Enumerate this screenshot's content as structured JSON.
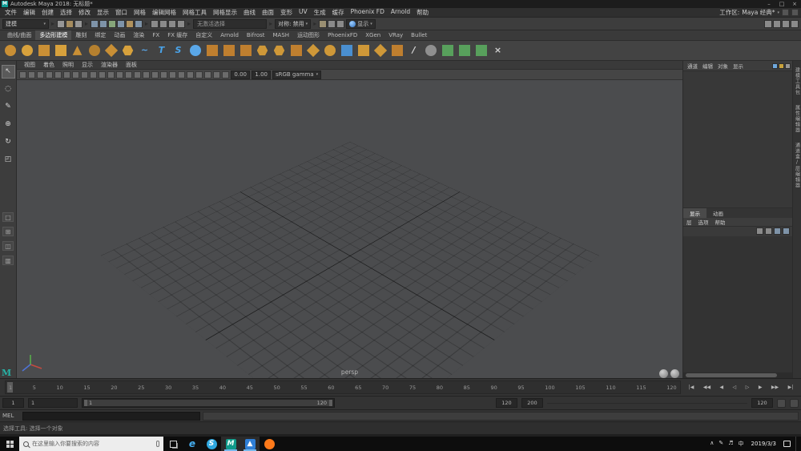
{
  "titlebar": {
    "app_glyph": "M",
    "title": "Autodesk Maya 2018: 无标题*",
    "minimize_glyph": "–",
    "maximize_glyph": "□",
    "close_glyph": "×"
  },
  "menubar": {
    "items": [
      "文件",
      "编辑",
      "创建",
      "选择",
      "修改",
      "显示",
      "窗口",
      "网格",
      "编辑网格",
      "网格工具",
      "网格显示",
      "曲线",
      "曲面",
      "变形",
      "UV",
      "生成",
      "缓存",
      "Phoenix FD",
      "Arnold",
      "帮助"
    ],
    "workspace_label": "工作区:",
    "workspace_value": "Maya 经典*"
  },
  "status_line": {
    "mode": "建模",
    "selection": "无激活选择",
    "symmetry": "对称: 禁用",
    "display": "显示",
    "file_icons": [
      {
        "name": "new-scene-icon",
        "bg": "#969696"
      },
      {
        "name": "open-scene-icon",
        "bg": "#a58c5f"
      },
      {
        "name": "save-scene-icon",
        "bg": "#969696"
      }
    ],
    "snap_icons": [
      {
        "name": "snap-to-grid-icon",
        "bg": "#7e93a8"
      },
      {
        "name": "snap-to-curve-icon",
        "bg": "#7e93a8"
      },
      {
        "name": "snap-to-point-icon",
        "bg": "#86a57a"
      },
      {
        "name": "snap-to-projected-center-icon",
        "bg": "#7e93a8"
      },
      {
        "name": "make-live-icon",
        "bg": "#b0925e"
      },
      {
        "name": "snap-to-view-plane-icon",
        "bg": "#7e93a8"
      }
    ],
    "history_icons": [
      {
        "name": "input-connections-icon",
        "bg": "#8a8a8a"
      },
      {
        "name": "output-connections-icon",
        "bg": "#8a8a8a"
      },
      {
        "name": "construction-history-icon",
        "bg": "#8a8a8a"
      },
      {
        "name": "highlight-selection-icon",
        "bg": "#8a8a8a"
      }
    ],
    "render_icons": [
      {
        "name": "render-current-frame-icon",
        "bg": "#9a8f72"
      },
      {
        "name": "ipr-render-icon",
        "bg": "#8a8a8a"
      },
      {
        "name": "render-settings-icon",
        "bg": "#8a8a8a"
      }
    ],
    "sidebar_toggles": [
      {
        "name": "attribute-editor-toggle-icon",
        "bg": "#8a8a8a"
      },
      {
        "name": "tool-settings-toggle-icon",
        "bg": "#8a8a8a"
      },
      {
        "name": "channel-box-toggle-icon",
        "bg": "#8a8a8a"
      },
      {
        "name": "modeling-toolkit-toggle-icon",
        "bg": "#8a8a8a"
      }
    ]
  },
  "shelf": {
    "tabs": [
      {
        "label": "曲线/曲面"
      },
      {
        "label": "多边形建模",
        "state": "active"
      },
      {
        "label": "雕刻"
      },
      {
        "label": "绑定"
      },
      {
        "label": "动画"
      },
      {
        "label": "渲染"
      },
      {
        "label": "FX"
      },
      {
        "label": "FX 缓存"
      },
      {
        "label": "自定义"
      },
      {
        "label": "Arnold"
      },
      {
        "label": "Bifrost"
      },
      {
        "label": "MASH"
      },
      {
        "label": "运动图形"
      },
      {
        "label": "PhoenixFD"
      },
      {
        "label": "XGen"
      },
      {
        "label": "VRay"
      },
      {
        "label": "Bullet"
      }
    ],
    "icons": [
      {
        "name": "poly-sphere-icon",
        "shape": "shp-circle",
        "bg": "#c98f35",
        "glyph": ""
      },
      {
        "name": "poly-smooth-sphere-icon",
        "shape": "shp-circle",
        "bg": "#d7a13c",
        "glyph": ""
      },
      {
        "name": "poly-cube-icon",
        "shape": "shp-square",
        "bg": "#c98f35",
        "glyph": ""
      },
      {
        "name": "poly-cylinder-icon",
        "shape": "shp-square",
        "bg": "#d7a13c",
        "glyph": ""
      },
      {
        "name": "poly-cone-icon",
        "shape": "shp-tri",
        "bg": "#c98f35",
        "glyph": ""
      },
      {
        "name": "poly-torus-icon",
        "shape": "shp-circle",
        "bg": "#b5802f",
        "glyph": ""
      },
      {
        "name": "poly-plane-icon",
        "shape": "shp-diamond",
        "bg": "#c98f35",
        "glyph": ""
      },
      {
        "name": "platonic-solid-icon",
        "shape": "shp-hex",
        "bg": "#d7a13c",
        "glyph": ""
      },
      {
        "name": "sweep-mesh-icon",
        "shape": "shp-letter",
        "fg": "#5aa7e8",
        "glyph": "~"
      },
      {
        "name": "poly-type-icon",
        "shape": "shp-letter",
        "fg": "#4aa3e8",
        "glyph": "T"
      },
      {
        "name": "svg-tool-icon",
        "shape": "shp-letter",
        "fg": "#4aa3e8",
        "glyph": "S"
      },
      {
        "name": "super-shape-icon",
        "shape": "shp-circle",
        "bg": "#5aa7e8",
        "glyph": ""
      },
      {
        "name": "boolean-union-icon",
        "shape": "shp-square",
        "bg": "#bf7f2f",
        "glyph": ""
      },
      {
        "name": "boolean-difference-icon",
        "shape": "shp-square",
        "bg": "#bf7f2f",
        "glyph": ""
      },
      {
        "name": "boolean-intersection-icon",
        "shape": "shp-square",
        "bg": "#bf7f2f",
        "glyph": ""
      },
      {
        "name": "combine-icon",
        "shape": "shp-hex",
        "bg": "#cf9838",
        "glyph": ""
      },
      {
        "name": "separate-icon",
        "shape": "shp-hex",
        "bg": "#cf9838",
        "glyph": ""
      },
      {
        "name": "extract-icon",
        "shape": "shp-square",
        "bg": "#bf7f2f",
        "glyph": ""
      },
      {
        "name": "merge-icon",
        "shape": "shp-diamond",
        "bg": "#cf9838",
        "glyph": ""
      },
      {
        "name": "smooth-icon",
        "shape": "shp-circle",
        "bg": "#cf9838",
        "glyph": ""
      },
      {
        "name": "mirror-icon",
        "shape": "shp-square",
        "bg": "#4a8fd0",
        "glyph": ""
      },
      {
        "name": "extrude-icon",
        "shape": "shp-square",
        "bg": "#cf9838",
        "glyph": ""
      },
      {
        "name": "bevel-icon",
        "shape": "shp-diamond",
        "bg": "#cf9838",
        "glyph": ""
      },
      {
        "name": "bridge-icon",
        "shape": "shp-square",
        "bg": "#bf7f2f",
        "glyph": ""
      },
      {
        "name": "multi-cut-icon",
        "shape": "shp-letter",
        "fg": "#d8d8d8",
        "glyph": "/"
      },
      {
        "name": "target-weld-icon",
        "shape": "shp-circle",
        "bg": "#8f8f8f",
        "glyph": ""
      },
      {
        "name": "quad-draw-icon",
        "shape": "shp-square",
        "bg": "#58a05c",
        "glyph": ""
      },
      {
        "name": "create-polygon-icon",
        "shape": "shp-square",
        "bg": "#58a05c",
        "glyph": ""
      },
      {
        "name": "sculpt-tool-icon",
        "shape": "shp-square",
        "bg": "#58a05c",
        "glyph": ""
      },
      {
        "name": "delete-history-icon",
        "shape": "shp-letter",
        "fg": "#cfcfcf",
        "glyph": "×"
      }
    ]
  },
  "panel_menu": {
    "items": [
      "视图",
      "着色",
      "照明",
      "显示",
      "渲染器",
      "面板"
    ]
  },
  "viewport_toolbar": {
    "icons": [
      {
        "name": "select-camera-icon"
      },
      {
        "name": "lock-camera-icon"
      },
      {
        "name": "camera-attributes-icon"
      },
      {
        "name": "bookmark-icon"
      },
      {
        "name": "image-plane-icon"
      },
      {
        "name": "2d-pan-zoom-icon"
      },
      {
        "name": "grease-pencil-icon"
      },
      {
        "name": "grid-icon"
      },
      {
        "name": "film-gate-icon"
      },
      {
        "name": "resolution-gate-icon"
      },
      {
        "name": "gate-mask-icon"
      },
      {
        "name": "field-chart-icon"
      },
      {
        "name": "safe-action-icon"
      },
      {
        "name": "safe-title-icon"
      },
      {
        "name": "wireframe-icon"
      },
      {
        "name": "shaded-icon"
      },
      {
        "name": "textured-icon"
      },
      {
        "name": "lights-icon"
      },
      {
        "name": "shadows-icon"
      },
      {
        "name": "ssao-icon"
      },
      {
        "name": "motion-blur-icon"
      },
      {
        "name": "multisample-aa-icon"
      },
      {
        "name": "depth-of-field-icon"
      },
      {
        "name": "isolate-select-icon"
      }
    ],
    "exposure": "0.00",
    "gamma": "1.00",
    "colorspace": "sRGB gamma"
  },
  "viewport": {
    "camera_label": "persp"
  },
  "toolbox": {
    "tools": [
      {
        "name": "select-tool-icon",
        "glyph": "↖",
        "state": "active"
      },
      {
        "name": "lasso-tool-icon",
        "glyph": "◌"
      },
      {
        "name": "paint-select-tool-icon",
        "glyph": "✎"
      },
      {
        "name": "move-tool-icon",
        "glyph": "⊕"
      },
      {
        "name": "rotate-tool-icon",
        "glyph": "↻"
      },
      {
        "name": "scale-tool-icon",
        "glyph": "◰"
      }
    ],
    "layouts": [
      {
        "name": "layout-single-pane-icon",
        "glyph": "□"
      },
      {
        "name": "layout-four-pane-icon",
        "glyph": "⊞"
      },
      {
        "name": "layout-two-pane-icon",
        "glyph": "◫"
      },
      {
        "name": "layout-outliner-pane-icon",
        "glyph": "▥"
      }
    ],
    "logo_glyph": "M"
  },
  "channel_box": {
    "menus": [
      "通道",
      "编辑",
      "对象",
      "显示"
    ],
    "corner_icons": [
      {
        "name": "channel-speed-icon",
        "bg": "#6fa8dc"
      },
      {
        "name": "channel-mode-icon",
        "bg": "#c9a23c"
      },
      {
        "name": "channel-settings-icon",
        "bg": "#969696"
      }
    ]
  },
  "layer_editor": {
    "tabs": [
      {
        "label": "显示",
        "state": "active"
      },
      {
        "label": "动画"
      }
    ],
    "menus": [
      "层",
      "选项",
      "帮助"
    ],
    "icons": [
      {
        "name": "layer-mode-icon",
        "bg": "#8a8a8a"
      },
      {
        "name": "layer-visibility-icon",
        "bg": "#8a8a8a"
      },
      {
        "name": "add-empty-layer-icon",
        "bg": "#7e93a8"
      },
      {
        "name": "add-layer-from-selected-icon",
        "bg": "#7e93a8"
      }
    ]
  },
  "sidebar_tabs": {
    "labels": [
      "建模工具包",
      "属性编辑器",
      "通道盒/层编辑器"
    ]
  },
  "time_slider": {
    "ticks": [
      "1",
      "5",
      "10",
      "15",
      "20",
      "25",
      "30",
      "35",
      "40",
      "45",
      "50",
      "55",
      "60",
      "65",
      "70",
      "75",
      "80",
      "85",
      "90",
      "95",
      "100",
      "105",
      "110",
      "115",
      "120"
    ],
    "transport": [
      {
        "name": "go-to-start-button",
        "glyph": "|◀"
      },
      {
        "name": "step-back-key-button",
        "glyph": "◀◀"
      },
      {
        "name": "step-back-frame-button",
        "glyph": "◀"
      },
      {
        "name": "play-backwards-button",
        "glyph": "◁"
      },
      {
        "name": "play-forwards-button",
        "glyph": "▷"
      },
      {
        "name": "step-forward-frame-button",
        "glyph": "▶"
      },
      {
        "name": "step-forward-key-button",
        "glyph": "▶▶"
      },
      {
        "name": "go-to-end-button",
        "glyph": "▶|"
      }
    ]
  },
  "range_slider": {
    "anim_start": "1",
    "play_start": "1",
    "bar_start": "1",
    "bar_end": "120",
    "play_end": "120",
    "anim_end": "200",
    "right_field": "120"
  },
  "command_line": {
    "label": "MEL"
  },
  "help_line": {
    "text": "选择工具: 选择一个对象"
  },
  "taskbar": {
    "search_placeholder": "在这里输入你要搜索的内容",
    "date": "2019/3/3",
    "apps": [
      {
        "name": "edge-browser-icon",
        "glyph": "e",
        "fg": "#45aef0",
        "bg": "transparent",
        "shape": "italic"
      },
      {
        "name": "skype-icon",
        "glyph": "S",
        "fg": "#ffffff",
        "bg": "#2fa8e0",
        "shape": "round"
      },
      {
        "name": "maya-taskbar-icon",
        "glyph": "M",
        "fg": "#eafff8",
        "bg": "#0f9a8a",
        "state": "active"
      },
      {
        "name": "photos-app-icon",
        "glyph": "▲",
        "fg": "#ffffff",
        "bg": "#2f7fd6",
        "state": "active"
      },
      {
        "name": "firefox-icon",
        "glyph": "",
        "fg": "#ffffff",
        "bg": "#ff7a1a",
        "shape": "round"
      }
    ],
    "tray": [
      {
        "name": "tray-expand-icon",
        "glyph": "∧"
      },
      {
        "name": "pen-settings-icon",
        "glyph": "✎"
      },
      {
        "name": "volume-icon",
        "glyph": "♬"
      },
      {
        "name": "ime-indicator",
        "glyph": "中"
      }
    ]
  }
}
